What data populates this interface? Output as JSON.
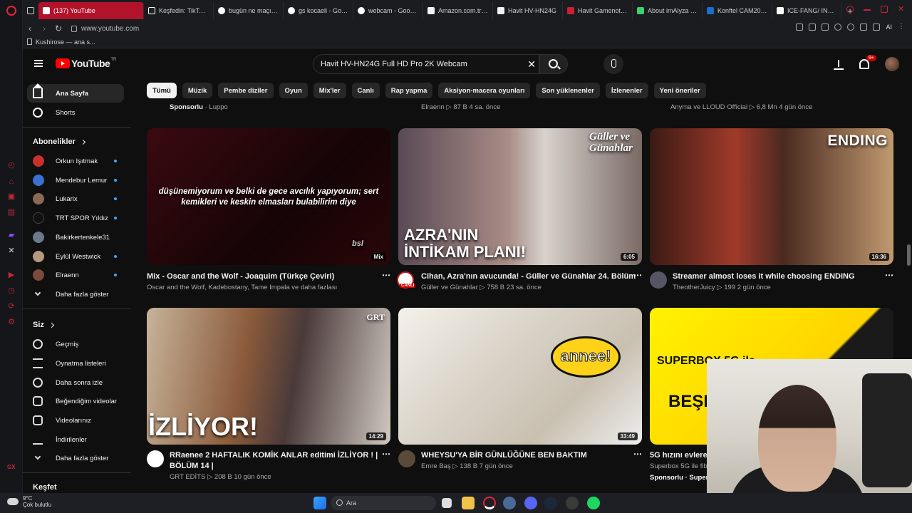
{
  "browser": {
    "tabs": [
      {
        "label": "(137) YouTube",
        "color": "#ff0000"
      },
      {
        "label": "Keşfedin: TikTok'ta",
        "color": "#ffffff"
      },
      {
        "label": "bugün ne maçı var",
        "color": "#ffffff"
      },
      {
        "label": "gs kocaeli - Googl",
        "color": "#ffffff"
      },
      {
        "label": "webcam - Google",
        "color": "#ffffff"
      },
      {
        "label": "Amazon.com.tr : m",
        "color": "#f3f3f3"
      },
      {
        "label": "Havit HV-HN24G",
        "color": "#f3f3f3"
      },
      {
        "label": "Havit Gamenote G",
        "color": "#d02030"
      },
      {
        "label": "About imAlyza - W",
        "color": "#3bd16f"
      },
      {
        "label": "Konftel CAM20 EP",
        "color": "#1a6fd1"
      },
      {
        "label": "ICE-FANG/ INTEL",
        "color": "#ffffff"
      }
    ],
    "url": "www.youtube.com",
    "bookmark": "Kushirose — ana s...",
    "ai_label": "AI"
  },
  "youtube": {
    "logo": "YouTube",
    "logo_country": "TR",
    "search_value": "Havit HV-HN24G Full HD Pro 2K Webcam",
    "notif_count": "9+",
    "sidebar": {
      "main": [
        {
          "label": "Ana Sayfa"
        },
        {
          "label": "Shorts"
        }
      ],
      "subs_header": "Abonelikler",
      "subs": [
        {
          "label": "Orkun Işıtmak",
          "color": "#c9302c"
        },
        {
          "label": "Mendebur Lemur",
          "color": "#3b6fd1"
        },
        {
          "label": "Lukarix",
          "color": "#8a6a55"
        },
        {
          "label": "TRT SPOR Yıldız",
          "color": "#111111"
        },
        {
          "label": "Bakirkertenkele31",
          "color": "#6a7a8a"
        },
        {
          "label": "Eylül Westwick",
          "color": "#b59a80"
        },
        {
          "label": "Elraenn",
          "color": "#7a4a3a"
        }
      ],
      "subs_more": "Daha fazla göster",
      "you_header": "Siz",
      "you": [
        {
          "label": "Geçmiş"
        },
        {
          "label": "Oynatma listeleri"
        },
        {
          "label": "Daha sonra izle"
        },
        {
          "label": "Beğendiğim videolar"
        },
        {
          "label": "Videolarınız"
        },
        {
          "label": "İndirilenler"
        }
      ],
      "you_more": "Daha fazla göster",
      "explore_header": "Keşfet"
    },
    "chips": [
      "Tümü",
      "Müzik",
      "Pembe diziler",
      "Oyun",
      "Mix'ler",
      "Canlı",
      "Rap yapma",
      "Aksiyon-macera oyunları",
      "Son yüklenenler",
      "İzlenenler",
      "Yeni öneriler"
    ],
    "prev_row": [
      {
        "channel": "Sponsorlu",
        "meta": "· Luppo"
      },
      {
        "channel": "Elraenn",
        "meta": "▷ 87 B   4 sa. önce"
      },
      {
        "channel": "Anyma",
        "meta": "ve LLOUD Official  ▷ 6,8 Mn   4 gün önce"
      }
    ],
    "videos": [
      {
        "title": "Mix - Oscar and the Wolf - Joaquim (Türkçe Çeviri)",
        "meta": "Oscar and the Wolf, Kadebostany, Tame Impala ve daha fazlası",
        "badge": "Mix",
        "overlay": "düşünemiyorum ve belki de gece avcılık yapıyorum; sert kemikleri ve keskin elmasları bulabilirim diye",
        "overlay2": "bsl"
      },
      {
        "title": "Cihan, Azra'nın avucunda! - Güller ve Günahlar 24. Bölüm",
        "meta": "Güller ve Günahlar  ▷ 758 B   23 sa. önce",
        "duration": "6:05",
        "overlay": "AZRA'NIN İNTİKAM PLANI!",
        "logo": "Güller ve Günahlar",
        "live": "CANLI"
      },
      {
        "title": "Streamer almost loses it while choosing ENDING",
        "meta": "TheotherJuicy  ▷ 199   2 gün önce",
        "duration": "16:36",
        "overlay": "ENDING"
      },
      {
        "title": "RRaenee 2 HAFTALIK KOMİK ANLAR editimi İZLİYOR ! |",
        "title2": "BÖLÜM 14 |",
        "meta": "GRT EDİTS  ▷ 208 B   10 gün önce",
        "duration": "14:29",
        "overlay": "İZLİYOR!",
        "logo": "GRT"
      },
      {
        "title": "WHEYSU'YA BİR GÜNLÜĞÜNE BEN BAKTIM",
        "meta": "Emre Baş  ▷ 138 B   7 gün önce",
        "duration": "33:49",
        "overlay": "annee!"
      },
      {
        "title": "5G hızını evlere ta",
        "meta": "Superbox 5G ile fibe",
        "sponsor": "Sponsorlu · Superb",
        "overlay": "SUPERBOX 5G ile",
        "overlay2": "EV",
        "overlay3": "BEŞLE"
      }
    ]
  },
  "taskbar": {
    "temp": "9°C",
    "weather": "Çok bulutlu",
    "search": "Ara"
  }
}
